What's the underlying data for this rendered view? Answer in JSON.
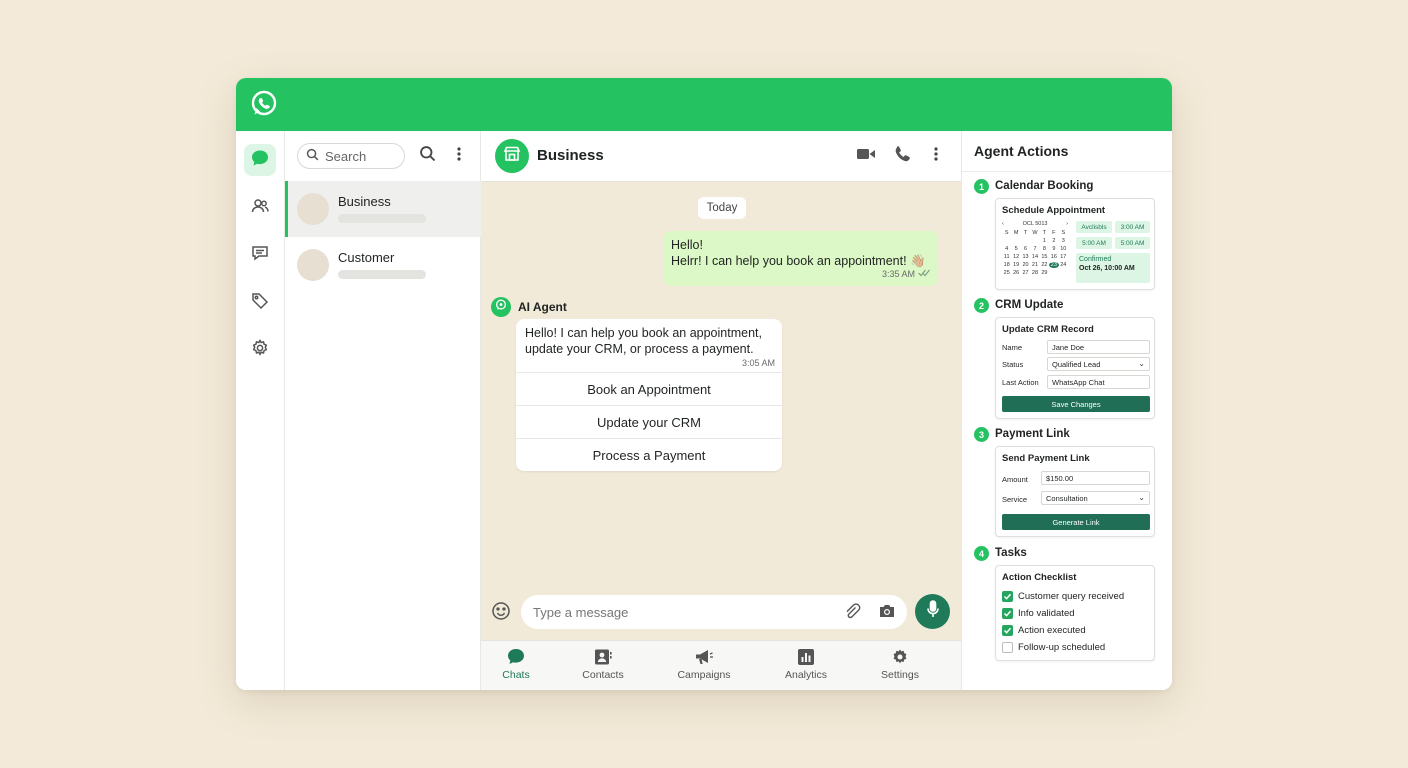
{
  "app": {
    "brand_color": "#25c262",
    "accent_dark": "#1f7a5a",
    "logo_icon": "whatsapp-logo-icon"
  },
  "rail": {
    "items": [
      {
        "name": "chats",
        "icon": "chat-bubble-icon",
        "active": true
      },
      {
        "name": "contacts",
        "icon": "people-icon",
        "active": false
      },
      {
        "name": "messages",
        "icon": "message-square-icon",
        "active": false
      },
      {
        "name": "tags",
        "icon": "tag-icon",
        "active": false
      },
      {
        "name": "settings",
        "icon": "gear-icon",
        "active": false
      }
    ]
  },
  "chatlist": {
    "search_placeholder": "Search",
    "chats": [
      {
        "name": "Business",
        "active": true
      },
      {
        "name": "Customer",
        "active": false
      }
    ]
  },
  "conversation": {
    "title": "Business",
    "day_label": "Today",
    "outgoing": {
      "line1": "Hello!",
      "line2": "Helrr! I can help you book an appointment! 👋🏼",
      "time": "3:35 AM"
    },
    "agent_name": "AI Agent",
    "incoming": {
      "text": "Hello! I can help you book an appointment, update your CRM, or process a payment.",
      "time": "3:05 AM",
      "quick_replies": [
        "Book an Appointment",
        "Update your CRM",
        "Process a Payment"
      ]
    },
    "composer_placeholder": "Type a message"
  },
  "bottom_nav": [
    {
      "label": "Chats",
      "icon": "chat-bubble-icon",
      "active": true
    },
    {
      "label": "Contacts",
      "icon": "contacts-card-icon",
      "active": false
    },
    {
      "label": "Campaigns",
      "icon": "megaphone-icon",
      "active": false
    },
    {
      "label": "Analytics",
      "icon": "bar-chart-icon",
      "active": false
    },
    {
      "label": "Settings",
      "icon": "gear-icon",
      "active": false
    }
  ],
  "agent_panel": {
    "title": "Agent Actions",
    "steps": [
      {
        "num": "1",
        "title": "Calendar Booking"
      },
      {
        "num": "2",
        "title": "CRM Update"
      },
      {
        "num": "3",
        "title": "Payment Link"
      },
      {
        "num": "4",
        "title": "Tasks"
      }
    ],
    "calendar": {
      "card_title": "Schedule Appointment",
      "month_label": "OCL 5013",
      "weekdays": [
        "S",
        "M",
        "T",
        "W",
        "T",
        "F",
        "S"
      ],
      "days": [
        "",
        "",
        "",
        "",
        "1",
        "2",
        "3",
        "4",
        "5",
        "6",
        "7",
        "8",
        "9",
        "10",
        "11",
        "12",
        "13",
        "14",
        "15",
        "16",
        "17",
        "18",
        "19",
        "20",
        "21",
        "22",
        "23",
        "24",
        "25",
        "26",
        "27",
        "28",
        "29",
        ""
      ],
      "selected_day": "23",
      "slots": [
        "Avclisbls",
        "3:00 AM",
        "5:00 AM",
        "5:00 AM"
      ],
      "confirmed_label": "Confirmed",
      "confirmed_value": "Oct 26, 10:00 AM"
    },
    "crm": {
      "card_title": "Update CRM Record",
      "fields": [
        {
          "label": "Name",
          "value": "Jane Doe",
          "dropdown": false
        },
        {
          "label": "Status",
          "value": "Qualified Lead",
          "dropdown": true
        },
        {
          "label": "Last Action",
          "value": "WhatsApp Chat",
          "dropdown": false
        }
      ],
      "button": "Save Changes"
    },
    "payment": {
      "card_title": "Send Payment Link",
      "fields": [
        {
          "label": "Amount",
          "value": "$150.00",
          "dropdown": false
        },
        {
          "label": "Service",
          "value": "Consultation",
          "dropdown": true
        }
      ],
      "button": "Generate Link"
    },
    "tasks": {
      "card_title": "Action Checklist",
      "items": [
        {
          "label": "Customer query received",
          "done": true
        },
        {
          "label": "Info validated",
          "done": true
        },
        {
          "label": "Action executed",
          "done": true
        },
        {
          "label": "Follow-up scheduled",
          "done": false
        }
      ]
    }
  }
}
